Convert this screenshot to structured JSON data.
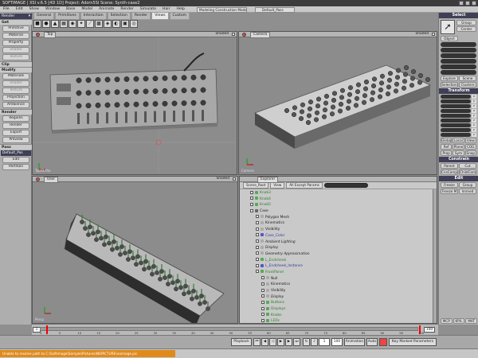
{
  "titlebar": {
    "text": "SOFTIMAGE | XSI v.6.5 [4D 1D] Project: Adorn5SI    Scene: Synth-case2"
  },
  "menubar": {
    "items": [
      "File",
      "Edit",
      "Show",
      "Window",
      "Base",
      "Model",
      "Animate",
      "Render",
      "Simulate",
      "Hair",
      "Help"
    ]
  },
  "tabs": {
    "items": [
      "General",
      "Primitives",
      "Interaction",
      "Selection",
      "Render",
      "Views",
      "Custom"
    ],
    "active": 5
  },
  "mode_dropdown": "Modeling Construction Mode",
  "pass_dropdown": "Default_Pass",
  "toolbar_icons": [
    "cube-icon",
    "sphere-icon",
    "cone-icon",
    "grid-icon",
    "camera-icon",
    "light-icon",
    "bone-icon",
    "texture-icon",
    "scene-icon",
    "material-icon",
    "render-icon",
    "globe-icon"
  ],
  "left": {
    "mode": "Render",
    "sections": [
      {
        "title": "Get",
        "items": [
          {
            "label": "Primitive",
            "dim": false
          },
          {
            "label": "Material",
            "dim": false
          },
          {
            "label": "Property",
            "dim": false
          },
          {
            "label": "Shader",
            "dim": true
          },
          {
            "label": "Texture",
            "dim": true
          }
        ]
      },
      {
        "title": "Clip",
        "items": []
      },
      {
        "title": "Modify",
        "items": [
          {
            "label": "Materials",
            "dim": false
          },
          {
            "label": "Shader",
            "dim": true
          },
          {
            "label": "Texture",
            "dim": true
          },
          {
            "label": "Projection",
            "dim": false
          },
          {
            "label": "Ambience",
            "dim": false
          }
        ]
      },
      {
        "title": "Render",
        "items": [
          {
            "label": "Regions",
            "dim": false
          },
          {
            "label": "Render",
            "dim": false
          },
          {
            "label": "Export",
            "dim": false
          },
          {
            "label": "Preview",
            "dim": false
          }
        ]
      }
    ],
    "pass_header": "Pass",
    "pass_value": "Default_Pas",
    "pass_buttons": [
      "Edit",
      "Partition"
    ]
  },
  "viewports": [
    {
      "name": "Top",
      "mode": "Shaded",
      "label": "Top/Ortho"
    },
    {
      "name": "Camera",
      "mode": "Shaded",
      "label": "Camera"
    },
    {
      "name": "User",
      "mode": "Shaded",
      "label": "Persp"
    }
  ],
  "explorer": {
    "title": "Explorer",
    "bar": [
      "Scene_Root",
      "View",
      "All Except Params"
    ],
    "tree": [
      {
        "label": "Knob3",
        "indent": 1,
        "color": "green",
        "icon": "#5a5"
      },
      {
        "label": "Knob4",
        "indent": 1,
        "color": "green",
        "icon": "#5a5"
      },
      {
        "label": "Knob5",
        "indent": 1,
        "color": "green",
        "icon": "#5a5"
      },
      {
        "label": "Case",
        "indent": 1,
        "color": "",
        "icon": "#666"
      },
      {
        "label": "Polygon Mesh",
        "indent": 2,
        "color": "",
        "icon": "#aaa"
      },
      {
        "label": "Kinematics",
        "indent": 2,
        "color": "",
        "icon": "#aaa"
      },
      {
        "label": "Visibility",
        "indent": 2,
        "color": "",
        "icon": "#aaa"
      },
      {
        "label": "Case_Color",
        "indent": 2,
        "color": "blue",
        "icon": "#55c"
      },
      {
        "label": "Ambient Lighting",
        "indent": 2,
        "color": "italic",
        "icon": "#aaa"
      },
      {
        "label": "Display",
        "indent": 2,
        "color": "italic",
        "icon": "#aaa"
      },
      {
        "label": "Geometry Approximation",
        "indent": 2,
        "color": "italic",
        "icon": "#aaa"
      },
      {
        "label": "L_Endcheek",
        "indent": 2,
        "color": "green",
        "icon": "#5a5"
      },
      {
        "label": "L_Endcheek_Instance",
        "indent": 2,
        "color": "blue",
        "icon": "#55c"
      },
      {
        "label": "FrontPanel",
        "indent": 2,
        "color": "green",
        "icon": "#5a5"
      },
      {
        "label": "Null",
        "indent": 3,
        "color": "",
        "icon": "#aaa"
      },
      {
        "label": "Kinematics",
        "indent": 3,
        "color": "",
        "icon": "#aaa"
      },
      {
        "label": "Visibility",
        "indent": 3,
        "color": "",
        "icon": "#aaa"
      },
      {
        "label": "Display",
        "indent": 3,
        "color": "italic",
        "icon": "#aaa"
      },
      {
        "label": "Buttons",
        "indent": 3,
        "color": "green",
        "icon": "#5a5"
      },
      {
        "label": "Displays",
        "indent": 3,
        "color": "green",
        "icon": "#5a5"
      },
      {
        "label": "Knobs",
        "indent": 3,
        "color": "green",
        "icon": "#5a5"
      },
      {
        "label": "LEDs",
        "indent": 3,
        "color": "green",
        "icon": "#5a5"
      },
      {
        "label": "Plug_Sockets",
        "indent": 2,
        "color": "green",
        "icon": "#5a5"
      },
      {
        "label": "Sliders",
        "indent": 2,
        "color": "green",
        "icon": "#5a5"
      }
    ]
  },
  "right": {
    "select_header": "Select",
    "select_buttons": [
      "Group",
      "Center",
      "Object"
    ],
    "explore_buttons": [
      "Explore",
      "Scene",
      "Selection",
      "Clusters"
    ],
    "transform_header": "Transform",
    "axis_labels": [
      "x",
      "y",
      "z"
    ],
    "global_buttons": [
      "Global",
      "Local",
      "View"
    ],
    "ref_buttons": [
      "Ref",
      "Plane",
      "COG",
      "Prop",
      "Sym",
      "Snap"
    ],
    "constrain_header": "Constrain",
    "constrain_buttons": [
      "Parent",
      "Cut",
      "CnsComp",
      "ChildComp"
    ],
    "edit_header": "Edit",
    "edit_buttons": [
      "Freeze",
      "Group",
      "Freeze M",
      "Immed"
    ],
    "side_tabs": [
      "MCP",
      "KP/L",
      "MAT"
    ]
  },
  "timeline": {
    "start": "1",
    "end": "100",
    "ticks": [
      "1",
      "5",
      "10",
      "15",
      "20",
      "25",
      "30",
      "35",
      "40",
      "45",
      "50",
      "55",
      "60",
      "65",
      "70",
      "75",
      "80",
      "85",
      "90",
      "95",
      "100"
    ]
  },
  "playbar": {
    "playback_label": "Playback",
    "frame": "1",
    "fps": "100",
    "animation_label": "Animation",
    "auto_label": "Auto",
    "key_marked_label": "Key Marked Parameters"
  },
  "status": {
    "message": "Unable to resolve path to C:\\Softimage\\Sample\\Pictures\\NOPICTURE\\noimage.pic"
  }
}
